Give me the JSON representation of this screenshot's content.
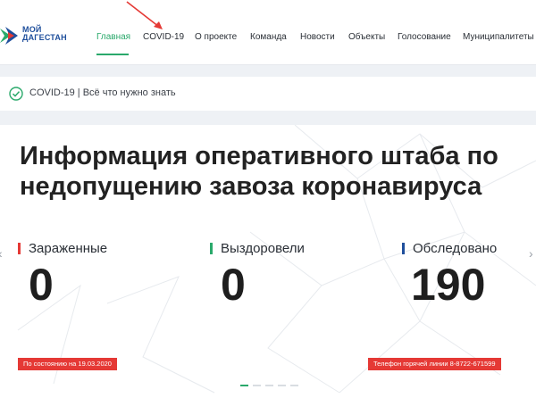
{
  "logo": {
    "line1": "МОЙ",
    "line2": "ДАГЕСТАН"
  },
  "nav": {
    "items": [
      {
        "label": "Главная",
        "active": true
      },
      {
        "label": "COVID-19"
      },
      {
        "label": "О проекте"
      },
      {
        "label": "Команда"
      },
      {
        "label": "Новости"
      },
      {
        "label": "Объекты"
      },
      {
        "label": "Голосование"
      },
      {
        "label": "Муниципалитеты"
      }
    ]
  },
  "strip": {
    "text": "COVID-19 | Всё что нужно знать"
  },
  "main": {
    "title": "Информация оперативного штаба по недопущению завоза коронавируса",
    "stats": [
      {
        "label": "Зараженные",
        "value": "0",
        "color": "#e53935"
      },
      {
        "label": "Выздоровели",
        "value": "0",
        "color": "#2aa96b"
      },
      {
        "label": "Обследовано",
        "value": "190",
        "color": "#1f4f9c"
      }
    ],
    "date_badge": "По состоянию на 19.03.2020",
    "hotline_badge": "Телефон горячей линии 8-8722-671599",
    "prev_icon": "‹",
    "next_icon": "›"
  },
  "colors": {
    "accent": "#2aa96b",
    "alert": "#e53935",
    "brand": "#1f4f9c"
  }
}
